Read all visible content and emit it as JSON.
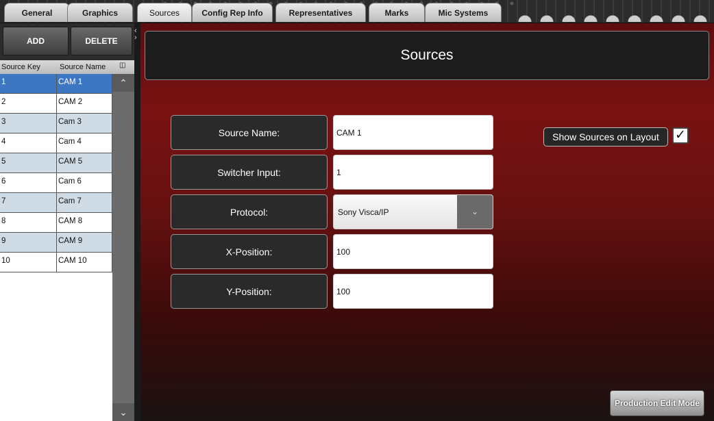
{
  "tabs": [
    "General",
    "Graphics",
    "Sources",
    "Config Rep Info",
    "Representatives",
    "Marks",
    "Mic Systems"
  ],
  "active_tab": "Sources",
  "left_panel": {
    "add_label": "ADD",
    "delete_label": "DELETE",
    "columns": [
      "Source Key",
      "Source Name"
    ],
    "rows": [
      {
        "key": "1",
        "name": "CAM 1"
      },
      {
        "key": "2",
        "name": "CAM 2"
      },
      {
        "key": "3",
        "name": "Cam 3"
      },
      {
        "key": "4",
        "name": "Cam 4"
      },
      {
        "key": "5",
        "name": "CAM 5"
      },
      {
        "key": "6",
        "name": "Cam 6"
      },
      {
        "key": "7",
        "name": "Cam 7"
      },
      {
        "key": "8",
        "name": "CAM 8"
      },
      {
        "key": "9",
        "name": "CAM 9"
      },
      {
        "key": "10",
        "name": "CAM 10"
      }
    ],
    "selected_row": "1"
  },
  "main": {
    "title": "Sources",
    "fields": {
      "source_name_label": "Source Name:",
      "source_name_value": "CAM 1",
      "switcher_input_label": "Switcher Input:",
      "switcher_input_value": "1",
      "protocol_label": "Protocol:",
      "protocol_value": "Sony Visca/IP",
      "x_position_label": "X-Position:",
      "x_position_value": "100",
      "y_position_label": "Y-Position:",
      "y_position_value": "100"
    },
    "show_sources_label": "Show Sources on Layout",
    "show_sources_checked": true,
    "production_edit_mode_label": "Production Edit Mode"
  },
  "colors": {
    "selection": "#3d77c4",
    "alt_row": "#cfdce6",
    "main_background": "#7a1212"
  }
}
